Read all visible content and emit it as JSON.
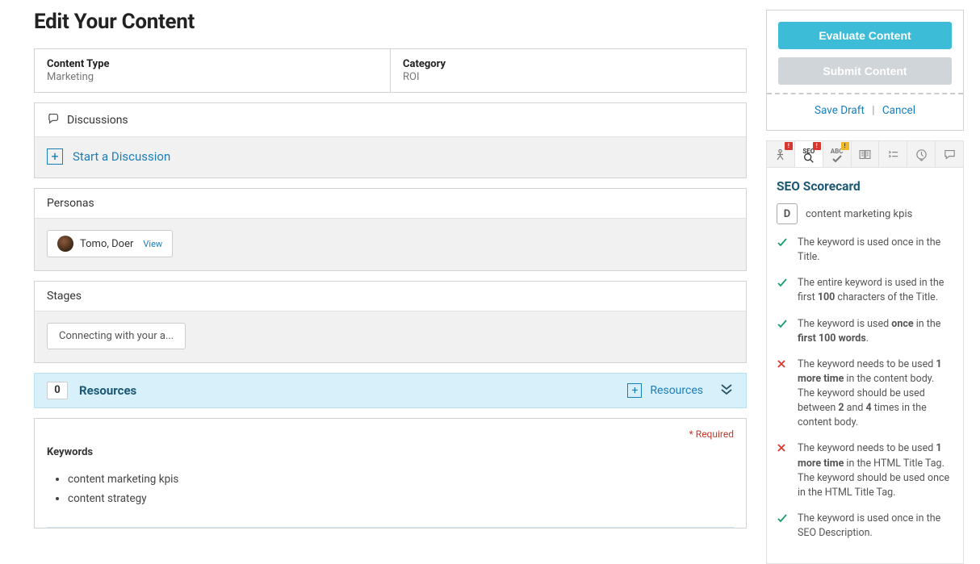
{
  "page_title": "Edit Your Content",
  "header": {
    "content_type_label": "Content Type",
    "content_type_value": "Marketing",
    "category_label": "Category",
    "category_value": "ROI"
  },
  "discussions": {
    "title": "Discussions",
    "start_label": "Start a Discussion"
  },
  "personas": {
    "title": "Personas",
    "item_name": "Tomo, Doer",
    "view_label": "View"
  },
  "stages": {
    "title": "Stages",
    "item_label": "Connecting with your a..."
  },
  "resources": {
    "count": "0",
    "label": "Resources",
    "add_label": "Resources"
  },
  "keywords": {
    "title": "Keywords",
    "required_label": "* Required",
    "items": [
      "content marketing kpis",
      "content strategy"
    ]
  },
  "sidebar": {
    "evaluate_label": "Evaluate Content",
    "submit_label": "Submit Content",
    "save_draft_label": "Save Draft",
    "cancel_label": "Cancel"
  },
  "tabs": {
    "seo_label": "SEO",
    "abc_label": "ABC"
  },
  "scorecard": {
    "title": "SEO Scorecard",
    "letter": "D",
    "keyword": "content marketing kpis",
    "rows": [
      {
        "status": "ok",
        "html": "The keyword is used once in the Title."
      },
      {
        "status": "ok",
        "html": "The entire keyword is used in the first <b>100</b> characters of the Title."
      },
      {
        "status": "ok",
        "html": "The keyword is used <b>once</b> in the <b>first 100 words</b>."
      },
      {
        "status": "bad",
        "html": "The keyword needs to be used <b>1 more time</b> in the content body. The keyword should be used between <b>2</b> and <b>4</b> times in the content body."
      },
      {
        "status": "bad",
        "html": "The keyword needs to be used <b>1 more time</b> in the HTML Title Tag. The keyword should be used once in the HTML Title Tag."
      },
      {
        "status": "ok",
        "html": "The keyword is used once in the SEO Description."
      }
    ]
  }
}
